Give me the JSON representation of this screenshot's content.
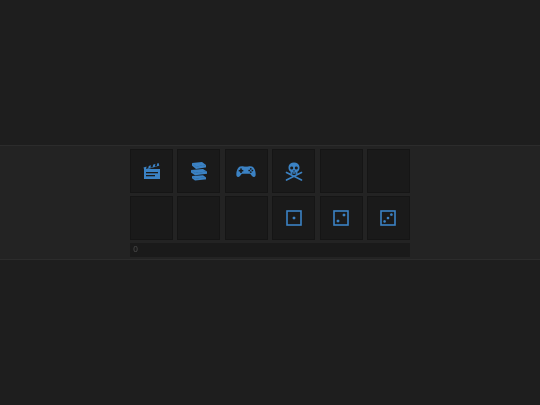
{
  "colors": {
    "background": "#1e1e1e",
    "band": "#232323",
    "tile": "#1a1a1a",
    "icon_accent": "#3b82c4"
  },
  "tiles": [
    {
      "icon": "clapperboard-icon",
      "empty": false
    },
    {
      "icon": "stack-of-books-icon",
      "empty": false
    },
    {
      "icon": "gamepad-icon",
      "empty": false
    },
    {
      "icon": "skull-crossbones-icon",
      "empty": false
    },
    {
      "icon": "",
      "empty": true
    },
    {
      "icon": "",
      "empty": true
    },
    {
      "icon": "",
      "empty": true
    },
    {
      "icon": "",
      "empty": true
    },
    {
      "icon": "",
      "empty": true
    },
    {
      "icon": "die-face-1-icon",
      "empty": false
    },
    {
      "icon": "die-face-2-icon",
      "empty": false
    },
    {
      "icon": "die-face-3-icon",
      "empty": false
    }
  ],
  "status_bar": {
    "text": "0"
  }
}
